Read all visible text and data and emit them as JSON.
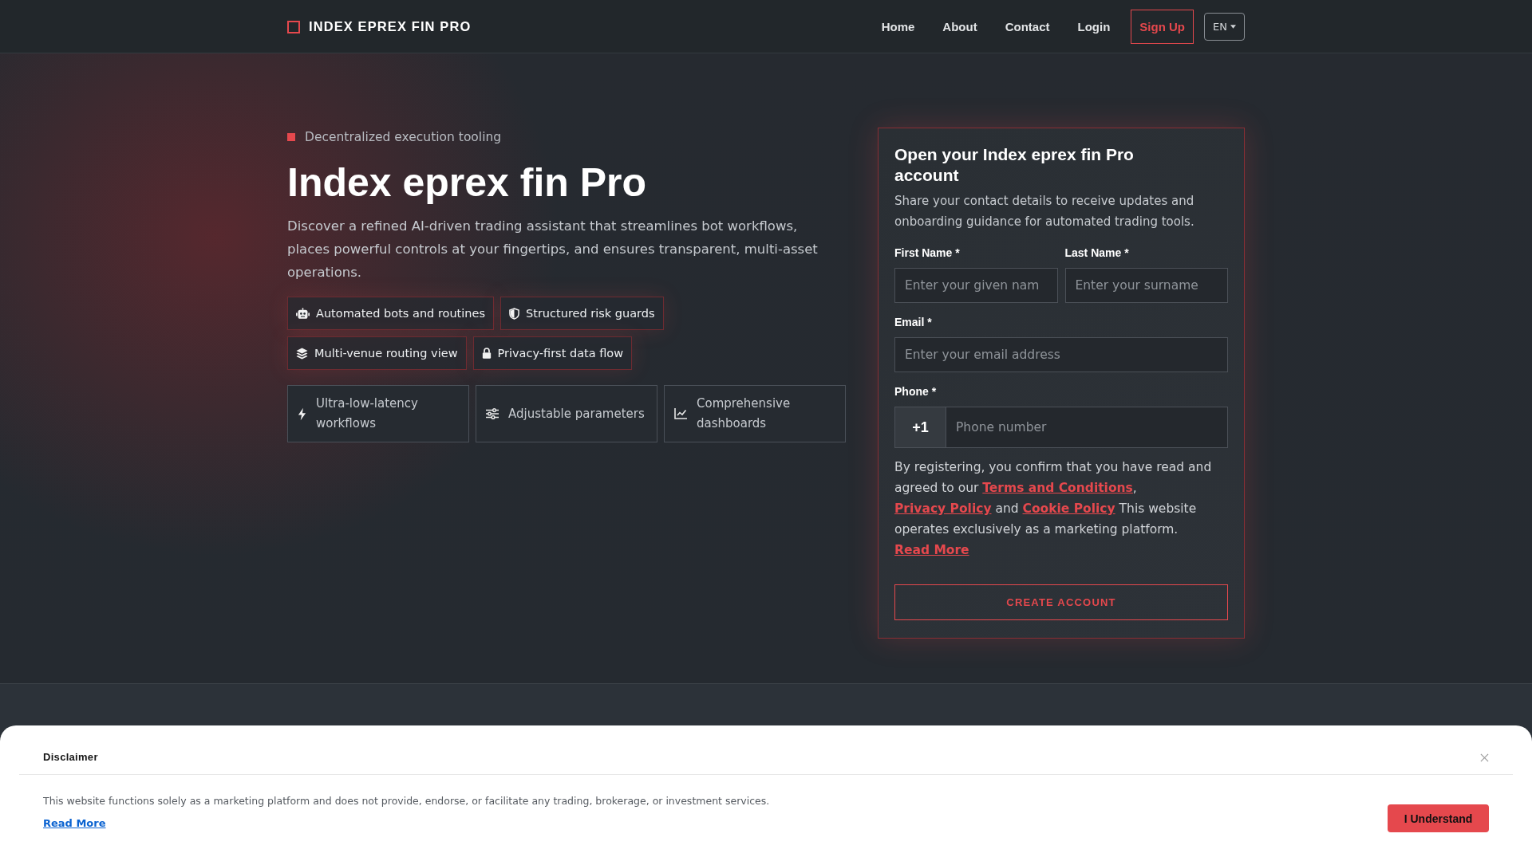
{
  "header": {
    "logo": "INDEX EPREX FIN PRO",
    "nav": [
      {
        "label": "Home"
      },
      {
        "label": "About"
      },
      {
        "label": "Contact"
      },
      {
        "label": "Login"
      }
    ],
    "signup_button": "Sign Up",
    "language": "EN"
  },
  "hero": {
    "tagline": "Decentralized execution tooling",
    "title": "Index eprex fin Pro",
    "description": "Discover a refined AI-driven trading assistant that streamlines bot workflows, places powerful controls at your fingertips, and ensures transparent, multi-asset operations.",
    "chips": [
      "Automated bots and routines",
      "Structured risk guards",
      "Multi-venue routing view",
      "Privacy-first data flow"
    ],
    "features": [
      "Ultra-low-latency workflows",
      "Adjustable parameters",
      "Comprehensive dashboards"
    ]
  },
  "signup_form": {
    "title": "Open your Index eprex fin Pro account",
    "subtitle": "Share your contact details to receive updates and onboarding guidance for automated trading tools.",
    "first_name": {
      "label": "First Name *",
      "placeholder": "Enter your given nam"
    },
    "last_name": {
      "label": "Last Name *",
      "placeholder": "Enter your surname"
    },
    "email": {
      "label": "Email *",
      "placeholder": "Enter your email address"
    },
    "phone": {
      "label": "Phone *",
      "prefix": "+1",
      "placeholder": "Phone number"
    },
    "consent": [
      {
        "kind": "text",
        "text": "By registering, you confirm that you have read and agreed to our "
      },
      {
        "kind": "link",
        "text": "Terms and Conditions"
      },
      {
        "kind": "text",
        "text": ", "
      },
      {
        "kind": "link",
        "text": "Privacy Policy"
      },
      {
        "kind": "text",
        "text": " and "
      },
      {
        "kind": "link",
        "text": "Cookie Policy"
      },
      {
        "kind": "text",
        "text": " This website operates exclusively as a marketing platform. "
      },
      {
        "kind": "link",
        "text": "Read More"
      }
    ],
    "submit_button": "CREATE ACCOUNT"
  },
  "disclaimer": {
    "title": "Disclaimer",
    "text": "This website functions solely as a marketing platform and does not provide, endorse, or facilitate any trading, brokerage, or investment services.",
    "read_more": "Read More",
    "button": "I Understand"
  }
}
